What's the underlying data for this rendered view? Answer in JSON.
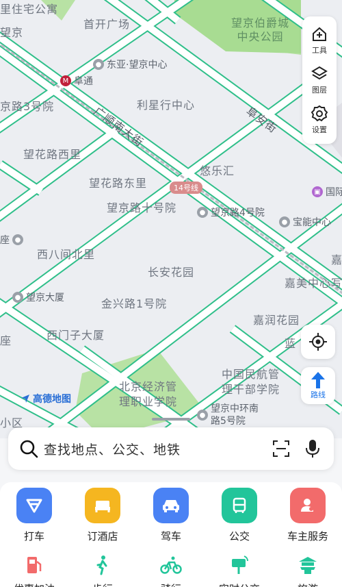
{
  "map": {
    "labels": {
      "top_left": "里住宅公寓",
      "wangjing_left": "望京",
      "shoukai": "首开广场",
      "park": "望京伯爵城\n中央公园",
      "dongya": "东亚·望京中心",
      "futong": "阜通",
      "road3": "京路3号院",
      "lixing": "利星行中心",
      "fuan": "阜安街",
      "guangshun": "广顺南大街",
      "whxl": "望花路西里",
      "youle": "悠乐汇",
      "whdl": "望花路东里",
      "line14": "14号线",
      "guoji": "国际",
      "wj10": "望京路十号院",
      "wj4": "望京路4号院",
      "baoneng": "宝能中心",
      "zuo": "座",
      "xibajian": "西八间北里",
      "jia": "嘉",
      "changan": "长安花园",
      "jiamei": "嘉美中心写",
      "wjds": "望京大厦",
      "jinxing": "金兴路1号院",
      "jiarun": "嘉润花园",
      "zuo2": "座",
      "xmz": "西门子大厦",
      "lan": "蓝",
      "bjjj": "北京经济管\n理职业学院",
      "minhang": "中国民航管\n理干部学院",
      "xiaoqu": "小区",
      "zhonghuan": "望京中环南\n路5号院"
    },
    "logo": "高德地图"
  },
  "toolbar": {
    "tools_label": "工具",
    "layers_label": "图层",
    "settings_label": "设置"
  },
  "route_label": "路线",
  "search": {
    "placeholder": "查找地点、公交、地铁"
  },
  "quick_actions": [
    {
      "label": "打车",
      "color": "#4a82f4"
    },
    {
      "label": "订酒店",
      "color": "#f5b620"
    },
    {
      "label": "驾车",
      "color": "#4a82f4"
    },
    {
      "label": "公交",
      "color": "#22c59a"
    },
    {
      "label": "车主服务",
      "color": "#f26b6b"
    }
  ],
  "secondary_actions": [
    {
      "label": "优惠加油",
      "color": "#f26b6b"
    },
    {
      "label": "步行",
      "color": "#22c59a"
    },
    {
      "label": "骑行",
      "color": "#22c59a"
    },
    {
      "label": "实时公交",
      "color": "#22c59a"
    },
    {
      "label": "旅游",
      "color": "#22c59a"
    }
  ]
}
